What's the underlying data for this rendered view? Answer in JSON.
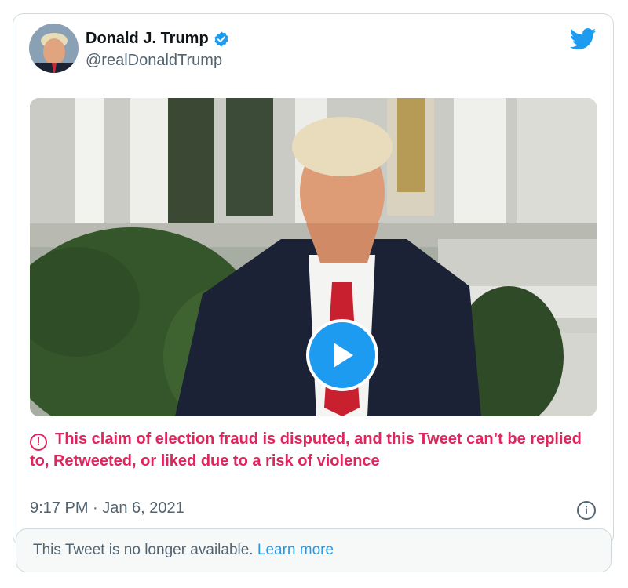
{
  "author": {
    "name": "Donald J. Trump",
    "handle": "@realDonaldTrump",
    "verified": true
  },
  "icons": {
    "brand": "twitter-bird-icon",
    "verified": "verified-badge-icon",
    "warning": "warning-circle-icon",
    "play": "play-icon",
    "info": "info-icon"
  },
  "warning_text": "This claim of election fraud is disputed, and this Tweet can’t be replied to, Retweeted, or liked due to a risk of violence",
  "warning_glyph": "!",
  "timestamp": "9:17 PM · Jan 6, 2021",
  "info_glyph": "i",
  "notice": {
    "text": "This Tweet is no longer available.",
    "link": "Learn more"
  },
  "colors": {
    "brand_blue": "#1d9bf0",
    "warning_red": "#e0245e",
    "secondary_text": "#536471"
  }
}
